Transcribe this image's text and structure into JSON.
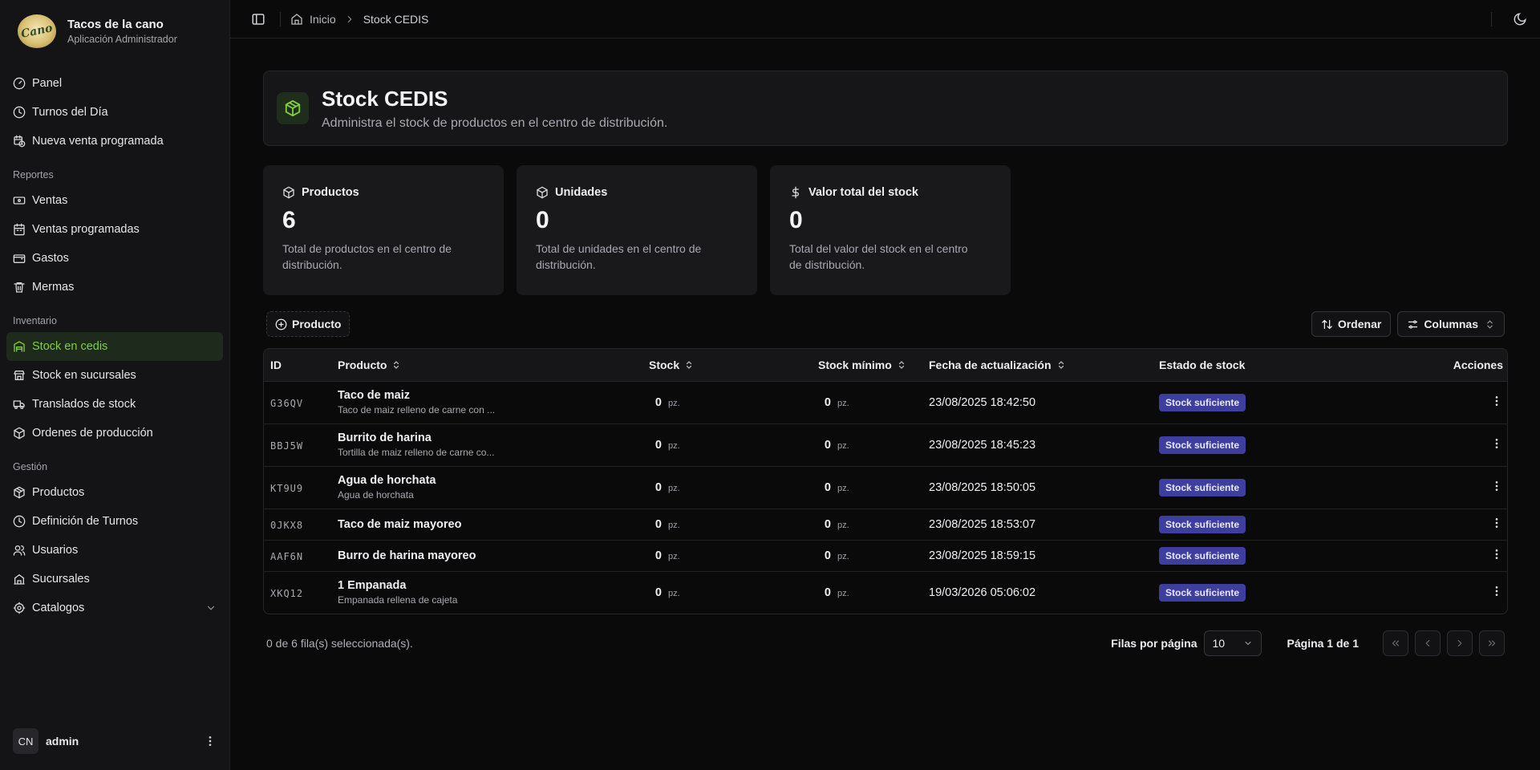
{
  "brand": {
    "logo_text": "Cano",
    "title": "Tacos de la cano",
    "subtitle": "Aplicación Administrador"
  },
  "nav": {
    "top": [
      {
        "label": "Panel",
        "icon": "gauge-icon"
      },
      {
        "label": "Turnos del Día",
        "icon": "clock-icon"
      },
      {
        "label": "Nueva venta programada",
        "icon": "calendar-clock-icon"
      }
    ],
    "reportes_label": "Reportes",
    "reportes": [
      {
        "label": "Ventas",
        "icon": "banknote-icon"
      },
      {
        "label": "Ventas programadas",
        "icon": "calendar-icon"
      },
      {
        "label": "Gastos",
        "icon": "wallet-icon"
      },
      {
        "label": "Mermas",
        "icon": "trash-icon"
      }
    ],
    "inventario_label": "Inventario",
    "inventario": [
      {
        "label": "Stock en cedis",
        "icon": "warehouse-icon",
        "active": true
      },
      {
        "label": "Stock en sucursales",
        "icon": "store-icon"
      },
      {
        "label": "Translados de stock",
        "icon": "truck-icon"
      },
      {
        "label": "Ordenes de producción",
        "icon": "package-icon"
      }
    ],
    "gestion_label": "Gestión",
    "gestion": [
      {
        "label": "Productos",
        "icon": "box-icon"
      },
      {
        "label": "Definición de Turnos",
        "icon": "clock-icon"
      },
      {
        "label": "Usuarios",
        "icon": "users-icon"
      },
      {
        "label": "Sucursales",
        "icon": "building-icon"
      },
      {
        "label": "Catalogos",
        "icon": "settings-icon"
      }
    ]
  },
  "user": {
    "initials": "CN",
    "name": "admin"
  },
  "breadcrumb": {
    "home": "Inicio",
    "current": "Stock CEDIS"
  },
  "header": {
    "title": "Stock CEDIS",
    "subtitle": "Administra el stock de productos en el centro de distribución."
  },
  "stats": [
    {
      "label": "Productos",
      "value": "6",
      "desc": "Total de productos en el centro de distribución."
    },
    {
      "label": "Unidades",
      "value": "0",
      "desc": "Total de unidades en el centro de distribución."
    },
    {
      "label": "Valor total del stock",
      "value": "0",
      "desc": "Total del valor del stock en el centro de distribución."
    }
  ],
  "toolbar": {
    "add_label": "Producto",
    "sort_label": "Ordenar",
    "columns_label": "Columnas"
  },
  "table": {
    "headers": {
      "id": "ID",
      "product": "Producto",
      "stock": "Stock",
      "min": "Stock mínimo",
      "date": "Fecha de actualización",
      "status": "Estado de stock",
      "actions": "Acciones"
    },
    "rows": [
      {
        "id": "G36QV",
        "name": "Taco de maiz",
        "desc": "Taco de maiz relleno de carne con ...",
        "stock": "0",
        "unit": "pz.",
        "min": "0",
        "min_unit": "pz.",
        "date": "23/08/2025 18:42:50",
        "status": "Stock suficiente"
      },
      {
        "id": "BBJ5W",
        "name": "Burrito de harina",
        "desc": "Tortilla de maiz relleno de carne co...",
        "stock": "0",
        "unit": "pz.",
        "min": "0",
        "min_unit": "pz.",
        "date": "23/08/2025 18:45:23",
        "status": "Stock suficiente"
      },
      {
        "id": "KT9U9",
        "name": "Agua de horchata",
        "desc": "Agua de horchata",
        "stock": "0",
        "unit": "pz.",
        "min": "0",
        "min_unit": "pz.",
        "date": "23/08/2025 18:50:05",
        "status": "Stock suficiente"
      },
      {
        "id": "0JKX8",
        "name": "Taco de maiz mayoreo",
        "desc": "",
        "stock": "0",
        "unit": "pz.",
        "min": "0",
        "min_unit": "pz.",
        "date": "23/08/2025 18:53:07",
        "status": "Stock suficiente"
      },
      {
        "id": "AAF6N",
        "name": "Burro de harina mayoreo",
        "desc": "",
        "stock": "0",
        "unit": "pz.",
        "min": "0",
        "min_unit": "pz.",
        "date": "23/08/2025 18:59:15",
        "status": "Stock suficiente"
      },
      {
        "id": "XKQ12",
        "name": "1 Empanada",
        "desc": "Empanada rellena de cajeta",
        "stock": "0",
        "unit": "pz.",
        "min": "0",
        "min_unit": "pz.",
        "date": "19/03/2026 05:06:02",
        "status": "Stock suficiente"
      }
    ]
  },
  "footer": {
    "selected": "0 de 6 fila(s) seleccionada(s).",
    "rows_label": "Filas por página",
    "rows_value": "10",
    "page": "Página 1 de 1"
  },
  "colors": {
    "accent": "#7fcf3f",
    "badge": "#3e3e9e",
    "background": "#0a0a0b"
  }
}
